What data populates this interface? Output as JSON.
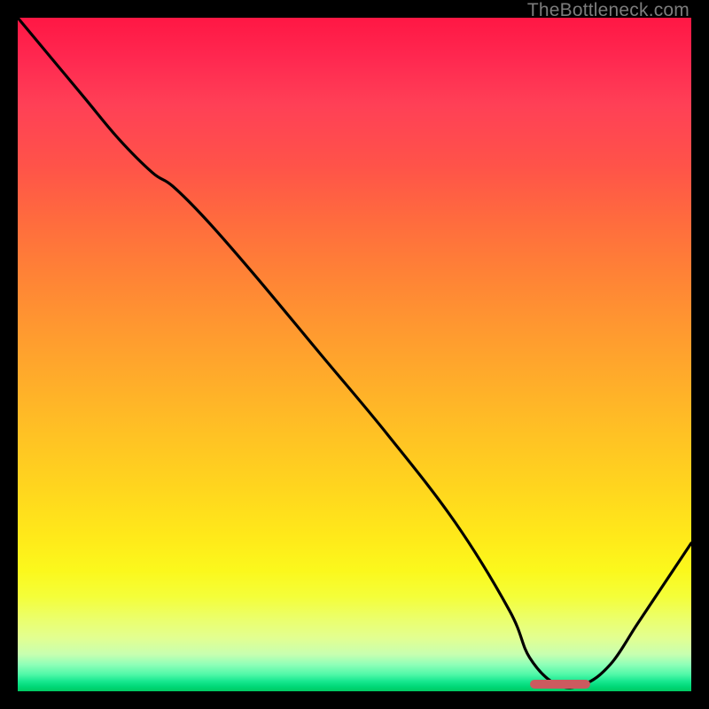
{
  "watermark": "TheBottleneck.com",
  "chart_data": {
    "type": "line",
    "title": "",
    "xlabel": "",
    "ylabel": "",
    "xlim": [
      0,
      100
    ],
    "ylim": [
      0,
      100
    ],
    "grid": false,
    "background_gradient": [
      "#ff1744",
      "#ffad2a",
      "#ffe91a",
      "#00c862"
    ],
    "series": [
      {
        "name": "bottleneck-curve",
        "color": "#000000",
        "x": [
          0,
          5,
          10,
          15,
          20,
          23,
          28,
          35,
          45,
          55,
          65,
          73,
          76,
          80,
          84,
          88,
          92,
          96,
          100
        ],
        "values": [
          100,
          94,
          88,
          82,
          77,
          75,
          70,
          62,
          50,
          38,
          25,
          12,
          5,
          1,
          1,
          4,
          10,
          16,
          22
        ]
      }
    ],
    "marker": {
      "name": "optimal-range",
      "color": "#cc5a5f",
      "x_start": 76,
      "x_end": 85,
      "y": 0.6
    }
  }
}
